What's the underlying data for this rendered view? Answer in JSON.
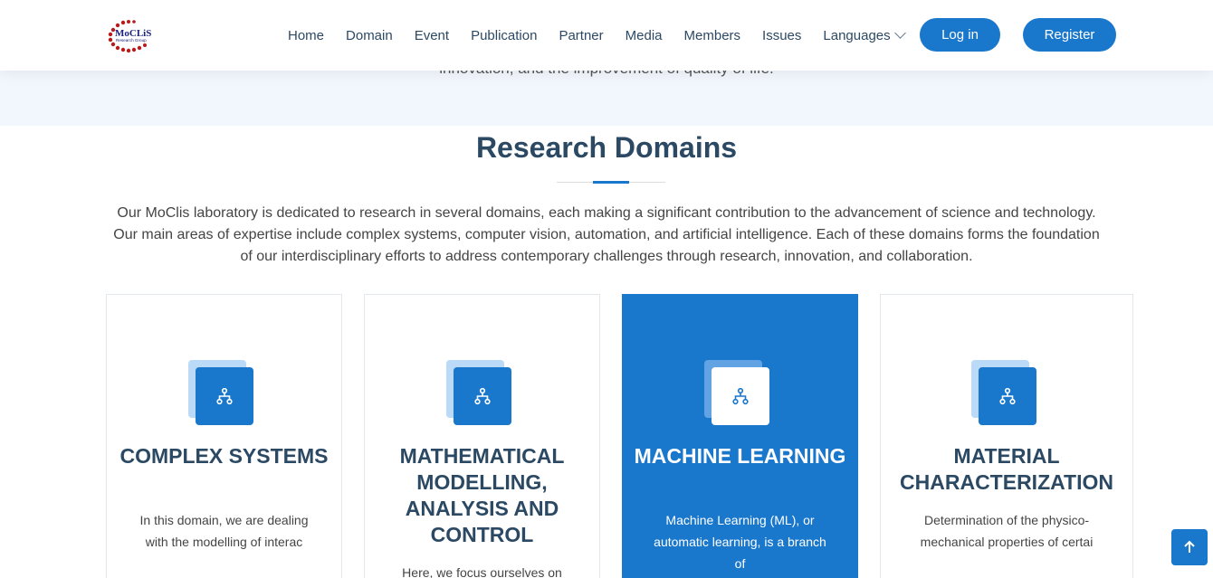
{
  "brand": {
    "logo_top": "MoCLiS",
    "logo_sub": "Research Group"
  },
  "nav": {
    "items": [
      "Home",
      "Domain",
      "Event",
      "Publication",
      "Partner",
      "Media",
      "Members",
      "Issues"
    ],
    "languages": "Languages",
    "login": "Log in",
    "register": "Register"
  },
  "hero": {
    "tail_text": "innovation, and the improvement of quality of life."
  },
  "section": {
    "title": "Research Domains",
    "intro": "Our MoClis laboratory is dedicated to research in several domains, each making a significant contribution to the advancement of science and technology. Our main areas of expertise include complex systems, computer vision, automation, and artificial intelligence. Each of these domains forms the foundation of our interdisciplinary efforts to address contemporary challenges through research, innovation, and collaboration."
  },
  "cards": [
    {
      "title": "COMPLEX SYSTEMS",
      "text": "In this domain, we are dealing with the modelling of interac",
      "icon": "sitemap-icon",
      "active": false
    },
    {
      "title": "MATHEMATICAL MODELLING, ANALYSIS AND CONTROL",
      "text": "Here, we focus ourselves on",
      "icon": "sitemap-icon",
      "active": false
    },
    {
      "title": "MACHINE LEARNING",
      "text": "Machine Learning (ML), or automatic learning, is a branch of",
      "icon": "sitemap-icon",
      "active": true
    },
    {
      "title": "MATERIAL CHARACTERIZATION",
      "text": "Determination of the physico-mechanical properties of certai",
      "icon": "sitemap-icon",
      "active": false
    }
  ],
  "colors": {
    "accent": "#1977cc",
    "heading": "#2c4964",
    "hero_bg": "#f2f6fd",
    "icon_back": "#badaf7"
  },
  "back_to_top_icon": "arrow-up-icon"
}
